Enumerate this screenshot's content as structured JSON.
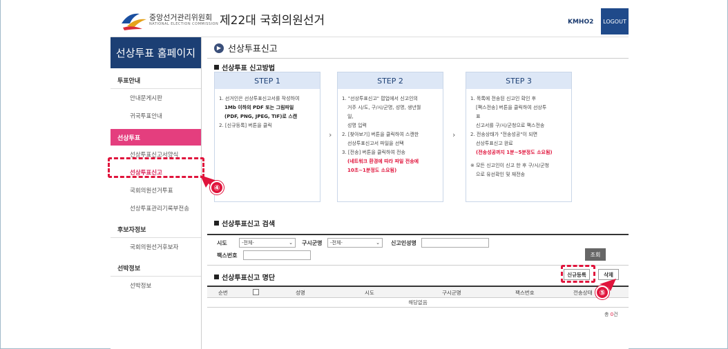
{
  "header": {
    "org_name": "중앙선거관리위원회",
    "org_sub": "NATIONAL ELECTION COMMISSION",
    "election_title": "제22대 국회의원선거",
    "user_id": "KMHO2",
    "logout_label": "LOGOUT"
  },
  "sidebar": {
    "title": "선상투표 홈페이지",
    "groups": [
      {
        "heading": "투표안내",
        "items": [
          "안내문게시판",
          "귀국투표안내"
        ]
      },
      {
        "heading": "선상투표",
        "items": [
          "선상투표신고서양식",
          "선상투표신고",
          "국회의원선거투표",
          "선상투표관리기록부전송"
        ]
      },
      {
        "heading": "후보자정보",
        "items": [
          "국회의원선거후보자"
        ]
      },
      {
        "heading": "선박정보",
        "items": [
          "선박정보"
        ]
      }
    ]
  },
  "main": {
    "page_title": "선상투표신고",
    "method_heading": "선상투표 신고방법",
    "steps": [
      {
        "title": "STEP 1",
        "lines": [
          "1. 선거인은 선상투표신고서를 작성하여",
          "1Mb 이하의 PDF 또는 그림파일",
          "(PDF, PNG, JPEG, TIF)로 스캔",
          "2. [신규등록] 버튼을 클릭"
        ]
      },
      {
        "title": "STEP 2",
        "lines": [
          "1. \"선상투표신고\" 팝업에서 신고인의",
          "거주 시/도, 구/시/군명, 성명, 생년월",
          "일,",
          "성명 입력",
          "2. [찾아보기] 버튼을 클릭하여 스캔한",
          "선상투표신고서 파일을 선택",
          "3. [전송] 버튼을 클릭하여 전송",
          "(네트워크 환경에 따라 파일 전송에",
          "10초~1분정도 소요됨)"
        ]
      },
      {
        "title": "STEP 3",
        "lines": [
          "1. 목록에 전송된 신고인 확인 후",
          "[팩스전송] 버튼을 클릭하여 선상투",
          "표",
          "신고서를 구/시/군청으로 팩스전송",
          "2. 전송상태가 \"전송성공\"이 되면",
          "선상투표신고 완료",
          "(전송성공까지 1분~5분정도 소요됨)",
          "※ 모든 신고인이 신고 한 후 구/시/군청",
          "으로 유선확인 및 재전송"
        ]
      }
    ],
    "search": {
      "heading": "선상투표신고 검색",
      "sido_label": "시도",
      "sido_value": "-전체-",
      "gusigun_label": "구시군명",
      "gusigun_value": "-전체-",
      "name_label": "신고인성명",
      "fax_label": "팩스번호",
      "search_button": "조회"
    },
    "list": {
      "heading": "선상투표신고 명단",
      "new_button": "신규등록",
      "delete_button": "삭제",
      "columns": [
        "순번",
        "성명",
        "시도",
        "구시군명",
        "팩스번호",
        "전송상태"
      ],
      "empty_text": "해당없음",
      "total_prefix": "총 ",
      "total_count": "0",
      "total_suffix": "건"
    }
  },
  "annotations": {
    "badge_4": "④",
    "badge_5": "⑤",
    "color": "#e0143c"
  }
}
